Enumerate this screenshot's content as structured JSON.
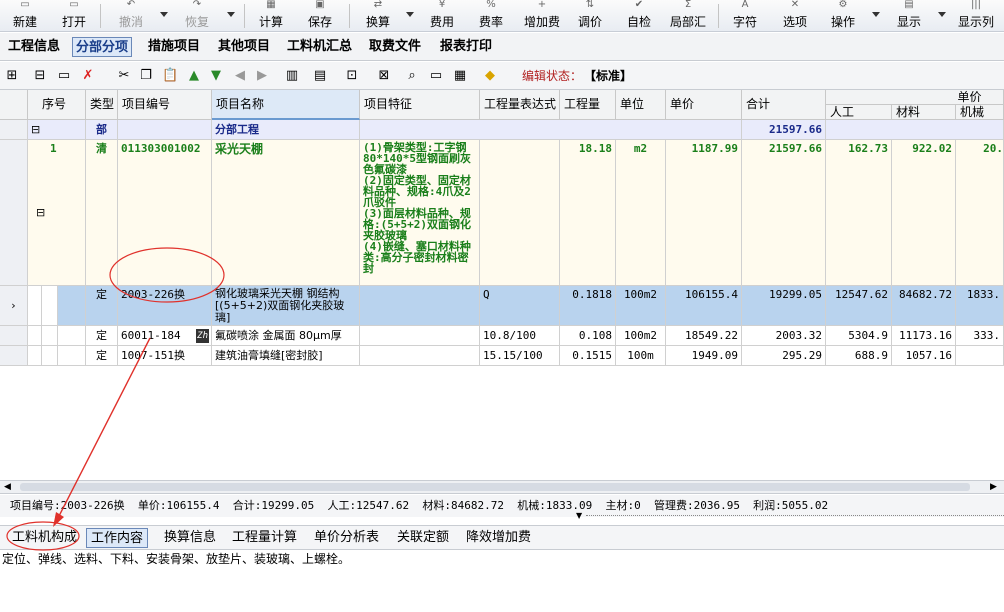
{
  "toolbar": {
    "buttons": [
      {
        "label": "新建",
        "icon": "new-file-icon"
      },
      {
        "label": "打开",
        "icon": "open-folder-icon"
      },
      {
        "label": "撤消",
        "icon": "undo-icon",
        "disabled": true
      },
      {
        "label": "恢复",
        "icon": "redo-icon",
        "disabled": true
      },
      {
        "label": "计算",
        "icon": "calculator-icon"
      },
      {
        "label": "保存",
        "icon": "save-icon"
      },
      {
        "label": "换算",
        "icon": "convert-icon"
      },
      {
        "label": "费用",
        "icon": "fee-icon"
      },
      {
        "label": "费率",
        "icon": "rate-icon"
      },
      {
        "label": "增加费",
        "icon": "add-fee-icon"
      },
      {
        "label": "调价",
        "icon": "adjust-price-icon"
      },
      {
        "label": "自检",
        "icon": "self-check-icon"
      },
      {
        "label": "局部汇",
        "icon": "partial-summary-icon"
      },
      {
        "label": "字符",
        "icon": "font-icon"
      },
      {
        "label": "选项",
        "icon": "options-icon"
      },
      {
        "label": "操作",
        "icon": "operate-icon"
      },
      {
        "label": "显示",
        "icon": "display-icon"
      },
      {
        "label": "显示列",
        "icon": "columns-icon"
      }
    ]
  },
  "tabs": [
    "工程信息",
    "分部分项",
    "措施项目",
    "其他项目",
    "工料机汇总",
    "取费文件",
    "报表打印"
  ],
  "edit_status": {
    "label": "编辑状态：",
    "value": "【标准】"
  },
  "grid": {
    "headers": [
      "序号",
      "类型",
      "项目编号",
      "项目名称",
      "项目特征",
      "工程量表达式",
      "工程量",
      "单位",
      "单价",
      "合计"
    ],
    "unit_price_group": "单价",
    "unit_price_sub": [
      "人工",
      "材料",
      "机械"
    ],
    "rows": {
      "section": {
        "toggle": "⊟",
        "type": "部",
        "name": "分部工程",
        "total": "21597.66"
      },
      "item": {
        "seq": "1",
        "type": "清",
        "code": "011303001002",
        "name": "采光天棚",
        "features": "(1)骨架类型:工字钢80*140*5型钢面刷灰色氟碳漆\n(2)固定类型、固定材料品种、规格:4爪及2爪驳件\n(3)面层材料品种、规格:(5+5+2)双面钢化夹胶玻璃\n(4)嵌缝、塞口材料种类:高分子密封材料密封",
        "qty": "18.18",
        "unit": "m2",
        "price": "1187.99",
        "total": "21597.66",
        "labor": "162.73",
        "material": "922.02",
        "machine": "20."
      },
      "subs": [
        {
          "marker": "›",
          "type": "定",
          "code": "2003-226换",
          "name": "钢化玻璃采光天棚 钢结构[(5+5+2)双面钢化夹胶玻璃]",
          "expr": "Q",
          "qty": "0.1818",
          "unit": "100m2",
          "price": "106155.4",
          "total": "19299.05",
          "labor": "12547.62",
          "material": "84682.72",
          "machine": "1833."
        },
        {
          "marker": "",
          "type": "定",
          "code": "60011-184",
          "badge": "Zh",
          "name": "氟碳喷涂 金属面 80μm厚",
          "expr": "10.8/100",
          "qty": "0.108",
          "unit": "100m2",
          "price": "18549.22",
          "total": "2003.32",
          "labor": "5304.9",
          "material": "11173.16",
          "machine": "333."
        },
        {
          "marker": "",
          "type": "定",
          "code": "1007-151换",
          "name": "建筑油膏填缝[密封胶]",
          "expr": "15.15/100",
          "qty": "0.1515",
          "unit": "100m",
          "price": "1949.09",
          "total": "295.29",
          "labor": "688.9",
          "material": "1057.16",
          "machine": ""
        }
      ]
    }
  },
  "status_line": "项目编号:2003-226换  单价:106155.4  合计:19299.05  人工:12547.62  材料:84682.72  机械:1833.09  主材:0  管理费:2036.95  利润:5055.02",
  "bottom_tabs": [
    "工料机构成",
    "工作内容",
    "换算信息",
    "工程量计算",
    "单价分析表",
    "关联定额",
    "降效增加费"
  ],
  "work_content": "定位、弹线、选料、下料、安装骨架、放垫片、装玻璃、上螺栓。",
  "colors": {
    "selected_row": "#b9d3ee",
    "section_row": "#e9ebfb",
    "item_row": "#fffbee",
    "annotation": "#e0312b"
  }
}
